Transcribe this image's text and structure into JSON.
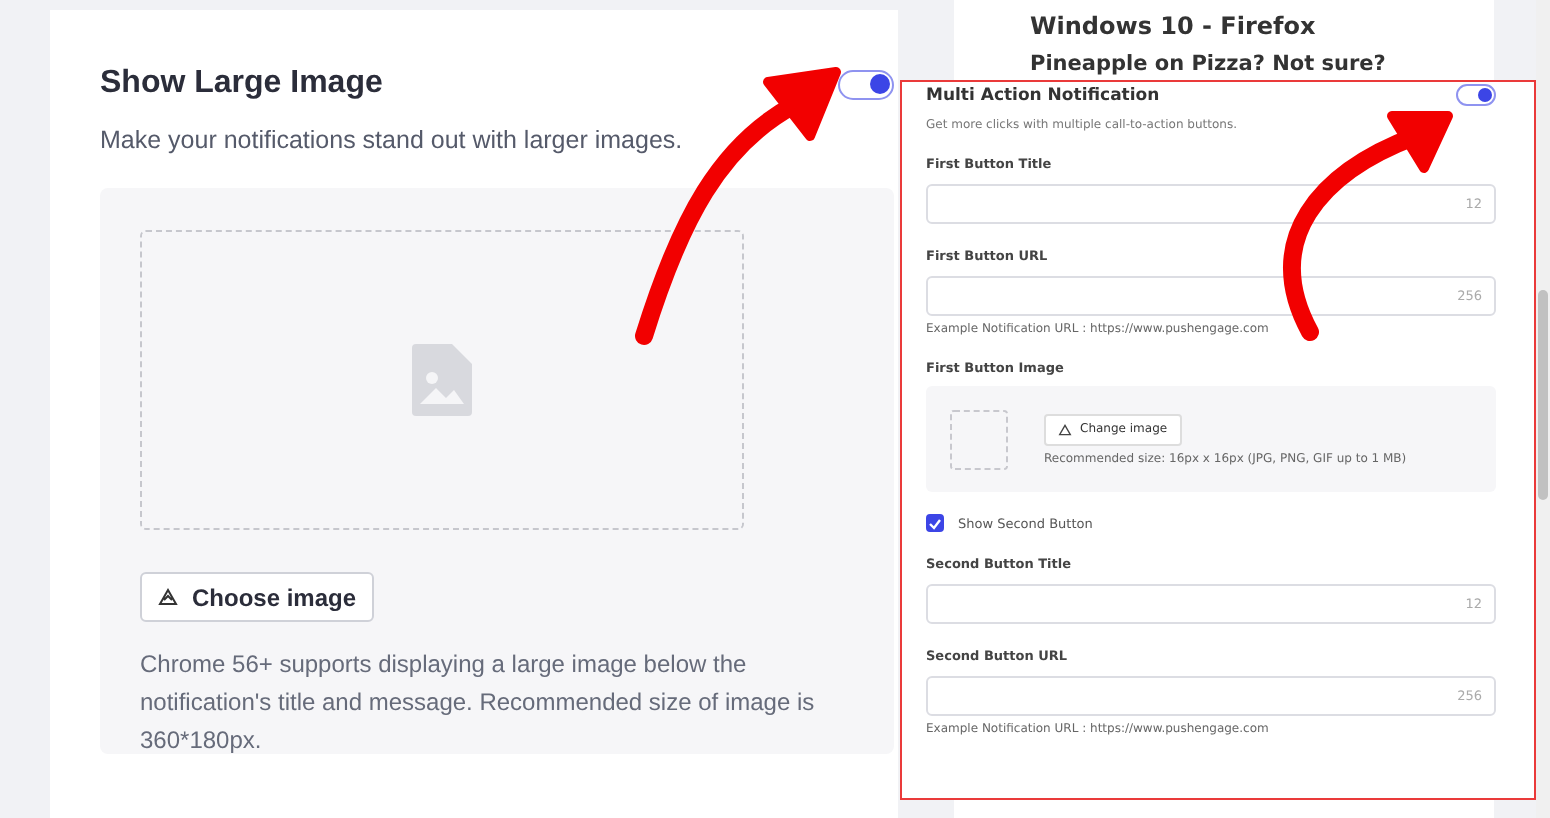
{
  "settings_card": {
    "title": "Show Large Image",
    "toggle_on": true,
    "description": "Make your notifications stand out with larger images.",
    "choose_button": "Choose image",
    "note": "Chrome 56+ supports displaying a large image below the notification's title and message. Recommended size of image is 360*180px."
  },
  "preview": {
    "title": "Windows 10 - Firefox",
    "notification_title": "Pineapple on Pizza? Not sure?"
  },
  "popup": {
    "title": "Multi Action Notification",
    "toggle_on": true,
    "description": "Get more clicks with multiple call-to-action buttons.",
    "fields": [
      {
        "kind": "text",
        "label": "First Button Title",
        "counter": "12"
      },
      {
        "kind": "text",
        "label": "First Button URL",
        "counter": "256",
        "hint": "Example Notification URL : https://www.pushengage.com"
      },
      {
        "kind": "image",
        "label": "First Button Image",
        "button": "Change image",
        "hint": "Recommended size: 16px x 16px (JPG, PNG, GIF up to 1 MB)"
      },
      {
        "kind": "checkbox",
        "label": "Show Second Button",
        "checked": true
      },
      {
        "kind": "text",
        "label": "Second Button Title",
        "counter": "12"
      },
      {
        "kind": "text",
        "label": "Second Button URL",
        "counter": "256",
        "hint": "Example Notification URL : https://www.pushengage.com"
      }
    ]
  }
}
